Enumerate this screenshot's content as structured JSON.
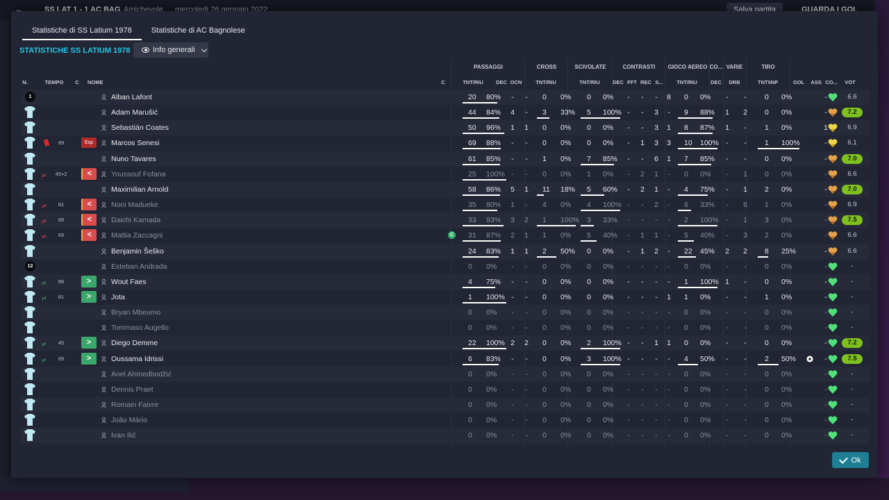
{
  "background": {
    "match_label": "SS LAT  1 - 1  AC BAG",
    "competition": "Amichevole",
    "date": "mercoledì 26 gennaio 2022",
    "save_button": "Salva partita",
    "watch_button": "GUARDA I GOL"
  },
  "tabs": [
    {
      "label": "Statistiche di SS Latium 1978"
    },
    {
      "label": "Statistiche di AC Bagnolese"
    }
  ],
  "section_title": "STATISTICHE SS LATIUM 1978",
  "view_select": {
    "label": "Info generali"
  },
  "group_headers": {
    "passaggi": "PASSAGGI",
    "cross": "CROSS",
    "scivolate": "SCIVOLATE",
    "contrasti": "CONTRASTI",
    "gioco_aereo": "GIOCO AEREO",
    "co": "CO...",
    "varie": "VARIE",
    "tiro": "TIRO"
  },
  "sub_headers": {
    "n": "N.",
    "tempo": "TEMPO",
    "c": "C",
    "nome": "NOME",
    "c2": "C",
    "pass_tnt": "TNT/RIU",
    "pass_dec": "DEC",
    "pass_ocn": "OCN",
    "cross_tnt": "TNT/RIU",
    "sciv_tnt": "TNT/RIU",
    "contr_dec": "DEC",
    "contr_fft": "FFT",
    "contr_rec": "REC",
    "contr_s": "S...",
    "aereo_tnt": "TNT/RIU",
    "co_dec": "DEC",
    "varie_drb": "DRB",
    "tiro_tnt": "TNT\\INP",
    "gol": "GOL",
    "ass": "ASS",
    "cond": "CO...",
    "vot": "VOT"
  },
  "icons": {
    "shirt": "shirt-icon",
    "person": "player-profile-icon",
    "heart": "condition-heart-icon",
    "sub": "substitution-arrows-icon",
    "ball": "goal-ball-icon",
    "check": "check-icon"
  },
  "colors": {
    "accent": "#22c7e8",
    "shirt": "#bfe9f3",
    "sub_out": "#d94c4c",
    "sub_in": "#3aa86a",
    "vote_high": "#7ec11f",
    "heart_green": "#4fe07a",
    "heart_orange": "#e2a14a",
    "ok_button": "#1d7e94"
  },
  "players": [
    {
      "n": "1",
      "tempo": "",
      "c": "",
      "name": "Alban Lafont",
      "cap": false,
      "pass_tnt": "20",
      "pass_riu": "80%",
      "pass_ratio": 0.8,
      "pass_dec": "-",
      "pass_ocn": "-",
      "cross_tnt": "0",
      "cross_riu": "0%",
      "cross_ratio": 0,
      "sciv_tnt": "0",
      "sciv_riu": "0%",
      "sciv_ratio": 0,
      "c_dec": "-",
      "c_fft": "-",
      "c_rec": "-",
      "c_s": "8",
      "aer_tnt": "0",
      "aer_riu": "0%",
      "aer_ratio": 0,
      "co_dec": "-",
      "drb": "-",
      "tiro_tnt": "0",
      "tiro_inp": "0%",
      "tiro_ratio": 0,
      "gol": "",
      "ass": "-",
      "heart": "green",
      "vot": "6.6",
      "vot_hi": false,
      "gk": true,
      "dim": false
    },
    {
      "n": "",
      "tempo": "",
      "c": "",
      "name": "Adam Marušić",
      "cap": false,
      "pass_tnt": "44",
      "pass_riu": "84%",
      "pass_ratio": 0.84,
      "pass_dec": "4",
      "pass_ocn": "-",
      "cross_tnt": "3",
      "cross_riu": "33%",
      "cross_ratio": 0.33,
      "sciv_tnt": "5",
      "sciv_riu": "100%",
      "sciv_ratio": 1,
      "c_dec": "-",
      "c_fft": "-",
      "c_rec": "3",
      "c_s": "-",
      "aer_tnt": "9",
      "aer_riu": "88%",
      "aer_ratio": 0.88,
      "co_dec": "1",
      "drb": "2",
      "tiro_tnt": "0",
      "tiro_inp": "0%",
      "tiro_ratio": 0,
      "gol": "",
      "ass": "-",
      "heart": "orange",
      "vot": "7.2",
      "vot_hi": true,
      "gk": false,
      "dim": false
    },
    {
      "n": "",
      "tempo": "",
      "c": "",
      "name": "Sebastián Coates",
      "cap": false,
      "pass_tnt": "50",
      "pass_riu": "96%",
      "pass_ratio": 0.96,
      "pass_dec": "1",
      "pass_ocn": "1",
      "cross_tnt": "0",
      "cross_riu": "0%",
      "cross_ratio": 0,
      "sciv_tnt": "0",
      "sciv_riu": "0%",
      "sciv_ratio": 0,
      "c_dec": "-",
      "c_fft": "-",
      "c_rec": "3",
      "c_s": "1",
      "aer_tnt": "8",
      "aer_riu": "87%",
      "aer_ratio": 0.87,
      "co_dec": "1",
      "drb": "-",
      "tiro_tnt": "1",
      "tiro_inp": "0%",
      "tiro_ratio": 0,
      "gol": "",
      "ass": "1",
      "heart": "yellow",
      "vot": "6.9",
      "vot_hi": false,
      "gk": false,
      "dim": false
    },
    {
      "n": "",
      "tempo": "89",
      "c": "Esp",
      "name": "Marcos Senesi",
      "cap": false,
      "pass_tnt": "69",
      "pass_riu": "88%",
      "pass_ratio": 0.88,
      "pass_dec": "-",
      "pass_ocn": "-",
      "cross_tnt": "0",
      "cross_riu": "0%",
      "cross_ratio": 0,
      "sciv_tnt": "0",
      "sciv_riu": "0%",
      "sciv_ratio": 0,
      "c_dec": "-",
      "c_fft": "1",
      "c_rec": "3",
      "c_s": "3",
      "aer_tnt": "10",
      "aer_riu": "100%",
      "aer_ratio": 1,
      "co_dec": "-",
      "drb": "-",
      "tiro_tnt": "1",
      "tiro_inp": "100%",
      "tiro_ratio": 1,
      "gol": "",
      "ass": "-",
      "heart": "yellow",
      "vot": "6.1",
      "vot_hi": false,
      "gk": false,
      "dim": false,
      "red": true
    },
    {
      "n": "",
      "tempo": "",
      "c": "",
      "name": "Nuno Tavares",
      "cap": false,
      "pass_tnt": "61",
      "pass_riu": "85%",
      "pass_ratio": 0.85,
      "pass_dec": "-",
      "pass_ocn": "-",
      "cross_tnt": "1",
      "cross_riu": "0%",
      "cross_ratio": 0,
      "sciv_tnt": "7",
      "sciv_riu": "85%",
      "sciv_ratio": 0.85,
      "c_dec": "-",
      "c_fft": "-",
      "c_rec": "6",
      "c_s": "1",
      "aer_tnt": "7",
      "aer_riu": "85%",
      "aer_ratio": 0.85,
      "co_dec": "-",
      "drb": "-",
      "tiro_tnt": "0",
      "tiro_inp": "0%",
      "tiro_ratio": 0,
      "gol": "",
      "ass": "-",
      "heart": "orange",
      "vot": "7.0",
      "vot_hi": true,
      "gk": false,
      "dim": false
    },
    {
      "n": "",
      "tempo": "45+2",
      "c": "out",
      "name": "Youssouf Fofana",
      "cap": false,
      "pass_tnt": "25",
      "pass_riu": "100%",
      "pass_ratio": 1,
      "pass_dec": "-",
      "pass_ocn": "-",
      "cross_tnt": "0",
      "cross_riu": "0%",
      "cross_ratio": 0,
      "sciv_tnt": "1",
      "sciv_riu": "0%",
      "sciv_ratio": 0,
      "c_dec": "-",
      "c_fft": "2",
      "c_rec": "1",
      "c_s": "-",
      "aer_tnt": "0",
      "aer_riu": "0%",
      "aer_ratio": 0,
      "co_dec": "-",
      "drb": "1",
      "tiro_tnt": "0",
      "tiro_inp": "0%",
      "tiro_ratio": 0,
      "gol": "",
      "ass": "-",
      "heart": "orange",
      "vot": "6.6",
      "vot_hi": false,
      "gk": false,
      "dim": true
    },
    {
      "n": "",
      "tempo": "",
      "c": "",
      "name": "Maximilian Arnold",
      "cap": false,
      "pass_tnt": "58",
      "pass_riu": "86%",
      "pass_ratio": 0.86,
      "pass_dec": "5",
      "pass_ocn": "1",
      "cross_tnt": "11",
      "cross_riu": "18%",
      "cross_ratio": 0.18,
      "sciv_tnt": "5",
      "sciv_riu": "60%",
      "sciv_ratio": 0.6,
      "c_dec": "-",
      "c_fft": "2",
      "c_rec": "1",
      "c_s": "-",
      "aer_tnt": "4",
      "aer_riu": "75%",
      "aer_ratio": 0.75,
      "co_dec": "-",
      "drb": "1",
      "tiro_tnt": "2",
      "tiro_inp": "0%",
      "tiro_ratio": 0,
      "gol": "",
      "ass": "-",
      "heart": "orange",
      "vot": "7.0",
      "vot_hi": true,
      "gk": false,
      "dim": false
    },
    {
      "n": "",
      "tempo": "81",
      "c": "out",
      "name": "Noni Madueke",
      "cap": false,
      "pass_tnt": "35",
      "pass_riu": "80%",
      "pass_ratio": 0.8,
      "pass_dec": "1",
      "pass_ocn": "-",
      "cross_tnt": "4",
      "cross_riu": "0%",
      "cross_ratio": 0,
      "sciv_tnt": "4",
      "sciv_riu": "100%",
      "sciv_ratio": 1,
      "c_dec": "-",
      "c_fft": "-",
      "c_rec": "2",
      "c_s": "-",
      "aer_tnt": "6",
      "aer_riu": "33%",
      "aer_ratio": 0.33,
      "co_dec": "-",
      "drb": "6",
      "tiro_tnt": "1",
      "tiro_inp": "0%",
      "tiro_ratio": 0,
      "gol": "",
      "ass": "-",
      "heart": "orange",
      "vot": "6.9",
      "vot_hi": false,
      "gk": false,
      "dim": true
    },
    {
      "n": "",
      "tempo": "89",
      "c": "out",
      "name": "Daichi Kamada",
      "cap": false,
      "pass_tnt": "33",
      "pass_riu": "93%",
      "pass_ratio": 0.93,
      "pass_dec": "3",
      "pass_ocn": "2",
      "cross_tnt": "1",
      "cross_riu": "100%",
      "cross_ratio": 1,
      "sciv_tnt": "3",
      "sciv_riu": "33%",
      "sciv_ratio": 0.33,
      "c_dec": "-",
      "c_fft": "-",
      "c_rec": "-",
      "c_s": "-",
      "aer_tnt": "2",
      "aer_riu": "100%",
      "aer_ratio": 1,
      "co_dec": "-",
      "drb": "1",
      "tiro_tnt": "3",
      "tiro_inp": "0%",
      "tiro_ratio": 0,
      "gol": "",
      "ass": "-",
      "heart": "orange",
      "vot": "7.5",
      "vot_hi": true,
      "gk": false,
      "dim": true
    },
    {
      "n": "",
      "tempo": "69",
      "c": "out",
      "name": "Mattia Zaccagni",
      "cap": true,
      "pass_tnt": "31",
      "pass_riu": "87%",
      "pass_ratio": 0.87,
      "pass_dec": "2",
      "pass_ocn": "1",
      "cross_tnt": "1",
      "cross_riu": "0%",
      "cross_ratio": 0,
      "sciv_tnt": "5",
      "sciv_riu": "40%",
      "sciv_ratio": 0.4,
      "c_dec": "-",
      "c_fft": "1",
      "c_rec": "1",
      "c_s": "-",
      "aer_tnt": "5",
      "aer_riu": "40%",
      "aer_ratio": 0.4,
      "co_dec": "-",
      "drb": "3",
      "tiro_tnt": "2",
      "tiro_inp": "0%",
      "tiro_ratio": 0,
      "gol": "",
      "ass": "-",
      "heart": "orange",
      "vot": "6.6",
      "vot_hi": false,
      "gk": false,
      "dim": true
    },
    {
      "n": "",
      "tempo": "",
      "c": "",
      "name": "Benjamin Šeško",
      "cap": false,
      "pass_tnt": "24",
      "pass_riu": "83%",
      "pass_ratio": 0.83,
      "pass_dec": "1",
      "pass_ocn": "1",
      "cross_tnt": "2",
      "cross_riu": "50%",
      "cross_ratio": 0.5,
      "sciv_tnt": "0",
      "sciv_riu": "0%",
      "sciv_ratio": 0,
      "c_dec": "-",
      "c_fft": "1",
      "c_rec": "2",
      "c_s": "-",
      "aer_tnt": "22",
      "aer_riu": "45%",
      "aer_ratio": 0.45,
      "co_dec": "2",
      "drb": "2",
      "tiro_tnt": "8",
      "tiro_inp": "25%",
      "tiro_ratio": 0.25,
      "gol": "",
      "ass": "-",
      "heart": "orange",
      "vot": "6.6",
      "vot_hi": false,
      "gk": false,
      "dim": false
    },
    {
      "n": "12",
      "tempo": "",
      "c": "",
      "name": "Esteban Andrada",
      "cap": false,
      "pass_tnt": "0",
      "pass_riu": "0%",
      "pass_ratio": 0,
      "pass_dec": "-",
      "pass_ocn": "-",
      "cross_tnt": "0",
      "cross_riu": "0%",
      "cross_ratio": 0,
      "sciv_tnt": "0",
      "sciv_riu": "0%",
      "sciv_ratio": 0,
      "c_dec": "-",
      "c_fft": "-",
      "c_rec": "-",
      "c_s": "-",
      "aer_tnt": "0",
      "aer_riu": "0%",
      "aer_ratio": 0,
      "co_dec": "-",
      "drb": "-",
      "tiro_tnt": "0",
      "tiro_inp": "0%",
      "tiro_ratio": 0,
      "gol": "",
      "ass": "-",
      "heart": "green",
      "vot": "-",
      "vot_hi": false,
      "gk": true,
      "dim": true
    },
    {
      "n": "",
      "tempo": "89",
      "c": "in",
      "name": "Wout Faes",
      "cap": false,
      "pass_tnt": "4",
      "pass_riu": "75%",
      "pass_ratio": 0.75,
      "pass_dec": "-",
      "pass_ocn": "-",
      "cross_tnt": "0",
      "cross_riu": "0%",
      "cross_ratio": 0,
      "sciv_tnt": "0",
      "sciv_riu": "0%",
      "sciv_ratio": 0,
      "c_dec": "-",
      "c_fft": "-",
      "c_rec": "-",
      "c_s": "-",
      "aer_tnt": "1",
      "aer_riu": "100%",
      "aer_ratio": 1,
      "co_dec": "1",
      "drb": "-",
      "tiro_tnt": "0",
      "tiro_inp": "0%",
      "tiro_ratio": 0,
      "gol": "",
      "ass": "-",
      "heart": "green",
      "vot": "-",
      "vot_hi": false,
      "gk": false,
      "dim": false
    },
    {
      "n": "",
      "tempo": "81",
      "c": "in",
      "name": "Jota",
      "cap": false,
      "pass_tnt": "1",
      "pass_riu": "100%",
      "pass_ratio": 1,
      "pass_dec": "-",
      "pass_ocn": "-",
      "cross_tnt": "0",
      "cross_riu": "0%",
      "cross_ratio": 0,
      "sciv_tnt": "0",
      "sciv_riu": "0%",
      "sciv_ratio": 0,
      "c_dec": "-",
      "c_fft": "-",
      "c_rec": "-",
      "c_s": "1",
      "aer_tnt": "1",
      "aer_riu": "0%",
      "aer_ratio": 0,
      "co_dec": "-",
      "drb": "-",
      "tiro_tnt": "1",
      "tiro_inp": "0%",
      "tiro_ratio": 0,
      "gol": "",
      "ass": "-",
      "heart": "green",
      "vot": "-",
      "vot_hi": false,
      "gk": false,
      "dim": false
    },
    {
      "n": "",
      "tempo": "",
      "c": "",
      "name": "Bryan Mbeumo",
      "cap": false,
      "pass_tnt": "0",
      "pass_riu": "0%",
      "pass_ratio": 0,
      "pass_dec": "-",
      "pass_ocn": "-",
      "cross_tnt": "0",
      "cross_riu": "0%",
      "cross_ratio": 0,
      "sciv_tnt": "0",
      "sciv_riu": "0%",
      "sciv_ratio": 0,
      "c_dec": "-",
      "c_fft": "-",
      "c_rec": "-",
      "c_s": "-",
      "aer_tnt": "0",
      "aer_riu": "0%",
      "aer_ratio": 0,
      "co_dec": "-",
      "drb": "-",
      "tiro_tnt": "0",
      "tiro_inp": "0%",
      "tiro_ratio": 0,
      "gol": "",
      "ass": "-",
      "heart": "green",
      "vot": "-",
      "vot_hi": false,
      "gk": false,
      "dim": true
    },
    {
      "n": "",
      "tempo": "",
      "c": "",
      "name": "Tommaso Augello",
      "cap": false,
      "pass_tnt": "0",
      "pass_riu": "0%",
      "pass_ratio": 0,
      "pass_dec": "-",
      "pass_ocn": "-",
      "cross_tnt": "0",
      "cross_riu": "0%",
      "cross_ratio": 0,
      "sciv_tnt": "0",
      "sciv_riu": "0%",
      "sciv_ratio": 0,
      "c_dec": "-",
      "c_fft": "-",
      "c_rec": "-",
      "c_s": "-",
      "aer_tnt": "0",
      "aer_riu": "0%",
      "aer_ratio": 0,
      "co_dec": "-",
      "drb": "-",
      "tiro_tnt": "0",
      "tiro_inp": "0%",
      "tiro_ratio": 0,
      "gol": "",
      "ass": "-",
      "heart": "green",
      "vot": "-",
      "vot_hi": false,
      "gk": false,
      "dim": true
    },
    {
      "n": "",
      "tempo": "45",
      "c": "in",
      "name": "Diego Demme",
      "cap": false,
      "pass_tnt": "22",
      "pass_riu": "100%",
      "pass_ratio": 1,
      "pass_dec": "2",
      "pass_ocn": "2",
      "cross_tnt": "0",
      "cross_riu": "0%",
      "cross_ratio": 0,
      "sciv_tnt": "2",
      "sciv_riu": "100%",
      "sciv_ratio": 1,
      "c_dec": "-",
      "c_fft": "-",
      "c_rec": "1",
      "c_s": "1",
      "aer_tnt": "0",
      "aer_riu": "0%",
      "aer_ratio": 0,
      "co_dec": "-",
      "drb": "-",
      "tiro_tnt": "0",
      "tiro_inp": "0%",
      "tiro_ratio": 0,
      "gol": "",
      "ass": "-",
      "heart": "green",
      "vot": "7.2",
      "vot_hi": true,
      "gk": false,
      "dim": false
    },
    {
      "n": "",
      "tempo": "69",
      "c": "in",
      "name": "Oussama Idrissi",
      "cap": false,
      "pass_tnt": "6",
      "pass_riu": "83%",
      "pass_ratio": 0.83,
      "pass_dec": "-",
      "pass_ocn": "-",
      "cross_tnt": "0",
      "cross_riu": "0%",
      "cross_ratio": 0,
      "sciv_tnt": "3",
      "sciv_riu": "100%",
      "sciv_ratio": 1,
      "c_dec": "-",
      "c_fft": "-",
      "c_rec": "-",
      "c_s": "-",
      "aer_tnt": "4",
      "aer_riu": "50%",
      "aer_ratio": 0.5,
      "co_dec": "-",
      "drb": "-",
      "tiro_tnt": "2",
      "tiro_inp": "50%",
      "tiro_ratio": 0.5,
      "gol": "ball",
      "ass": "-",
      "heart": "green",
      "vot": "7.5",
      "vot_hi": true,
      "gk": false,
      "dim": false
    },
    {
      "n": "",
      "tempo": "",
      "c": "",
      "name": "Anel Ahmedhodžić",
      "cap": false,
      "pass_tnt": "0",
      "pass_riu": "0%",
      "pass_ratio": 0,
      "pass_dec": "-",
      "pass_ocn": "-",
      "cross_tnt": "0",
      "cross_riu": "0%",
      "cross_ratio": 0,
      "sciv_tnt": "0",
      "sciv_riu": "0%",
      "sciv_ratio": 0,
      "c_dec": "-",
      "c_fft": "-",
      "c_rec": "-",
      "c_s": "-",
      "aer_tnt": "0",
      "aer_riu": "0%",
      "aer_ratio": 0,
      "co_dec": "-",
      "drb": "-",
      "tiro_tnt": "0",
      "tiro_inp": "0%",
      "tiro_ratio": 0,
      "gol": "",
      "ass": "-",
      "heart": "green",
      "vot": "-",
      "vot_hi": false,
      "gk": false,
      "dim": true
    },
    {
      "n": "",
      "tempo": "",
      "c": "",
      "name": "Dennis Praet",
      "cap": false,
      "pass_tnt": "0",
      "pass_riu": "0%",
      "pass_ratio": 0,
      "pass_dec": "-",
      "pass_ocn": "-",
      "cross_tnt": "0",
      "cross_riu": "0%",
      "cross_ratio": 0,
      "sciv_tnt": "0",
      "sciv_riu": "0%",
      "sciv_ratio": 0,
      "c_dec": "-",
      "c_fft": "-",
      "c_rec": "-",
      "c_s": "-",
      "aer_tnt": "0",
      "aer_riu": "0%",
      "aer_ratio": 0,
      "co_dec": "-",
      "drb": "-",
      "tiro_tnt": "0",
      "tiro_inp": "0%",
      "tiro_ratio": 0,
      "gol": "",
      "ass": "-",
      "heart": "green",
      "vot": "-",
      "vot_hi": false,
      "gk": false,
      "dim": true
    },
    {
      "n": "",
      "tempo": "",
      "c": "",
      "name": "Romain Faivre",
      "cap": false,
      "pass_tnt": "0",
      "pass_riu": "0%",
      "pass_ratio": 0,
      "pass_dec": "-",
      "pass_ocn": "-",
      "cross_tnt": "0",
      "cross_riu": "0%",
      "cross_ratio": 0,
      "sciv_tnt": "0",
      "sciv_riu": "0%",
      "sciv_ratio": 0,
      "c_dec": "-",
      "c_fft": "-",
      "c_rec": "-",
      "c_s": "-",
      "aer_tnt": "0",
      "aer_riu": "0%",
      "aer_ratio": 0,
      "co_dec": "-",
      "drb": "-",
      "tiro_tnt": "0",
      "tiro_inp": "0%",
      "tiro_ratio": 0,
      "gol": "",
      "ass": "-",
      "heart": "green",
      "vot": "-",
      "vot_hi": false,
      "gk": false,
      "dim": true
    },
    {
      "n": "",
      "tempo": "",
      "c": "",
      "name": "João Mário",
      "cap": false,
      "pass_tnt": "0",
      "pass_riu": "0%",
      "pass_ratio": 0,
      "pass_dec": "-",
      "pass_ocn": "-",
      "cross_tnt": "0",
      "cross_riu": "0%",
      "cross_ratio": 0,
      "sciv_tnt": "0",
      "sciv_riu": "0%",
      "sciv_ratio": 0,
      "c_dec": "-",
      "c_fft": "-",
      "c_rec": "-",
      "c_s": "-",
      "aer_tnt": "0",
      "aer_riu": "0%",
      "aer_ratio": 0,
      "co_dec": "-",
      "drb": "-",
      "tiro_tnt": "0",
      "tiro_inp": "0%",
      "tiro_ratio": 0,
      "gol": "",
      "ass": "-",
      "heart": "green",
      "vot": "-",
      "vot_hi": false,
      "gk": false,
      "dim": true
    },
    {
      "n": "",
      "tempo": "",
      "c": "",
      "name": "Ivan Ilić",
      "cap": false,
      "pass_tnt": "0",
      "pass_riu": "0%",
      "pass_ratio": 0,
      "pass_dec": "-",
      "pass_ocn": "-",
      "cross_tnt": "0",
      "cross_riu": "0%",
      "cross_ratio": 0,
      "sciv_tnt": "0",
      "sciv_riu": "0%",
      "sciv_ratio": 0,
      "c_dec": "-",
      "c_fft": "-",
      "c_rec": "-",
      "c_s": "-",
      "aer_tnt": "0",
      "aer_riu": "0%",
      "aer_ratio": 0,
      "co_dec": "-",
      "drb": "-",
      "tiro_tnt": "0",
      "tiro_inp": "0%",
      "tiro_ratio": 0,
      "gol": "",
      "ass": "-",
      "heart": "green",
      "vot": "-",
      "vot_hi": false,
      "gk": false,
      "dim": true
    }
  ],
  "ok_button": {
    "label": "Ok"
  }
}
